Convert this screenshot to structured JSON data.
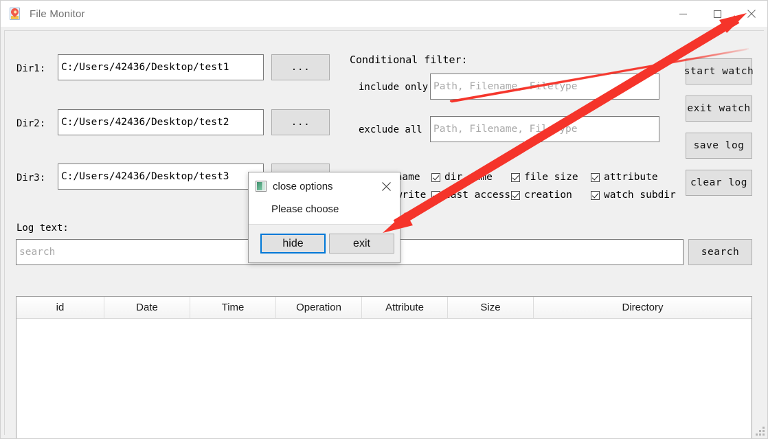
{
  "window": {
    "title": "File Monitor",
    "icon": "file-monitor-icon",
    "minimize_label": "—",
    "maximize_label": "□",
    "close_label": "✕"
  },
  "dirs": [
    {
      "label": "Dir1:",
      "value": "C:/Users/42436/Desktop/test1",
      "browse_label": "..."
    },
    {
      "label": "Dir2:",
      "value": "C:/Users/42436/Desktop/test2",
      "browse_label": "..."
    },
    {
      "label": "Dir3:",
      "value": "C:/Users/42436/Desktop/test3",
      "browse_label": "..."
    }
  ],
  "filter": {
    "heading": "Conditional filter:",
    "include": {
      "label": "include only",
      "value": "",
      "placeholder": "Path, Filename, Filetype"
    },
    "exclude": {
      "label": "exclude  all",
      "value": "",
      "placeholder": "Path, Filename, Filetype"
    }
  },
  "checkboxes": {
    "row1": [
      {
        "label": "file name",
        "checked": true
      },
      {
        "label": "dir name",
        "checked": true
      },
      {
        "label": "file size",
        "checked": true
      },
      {
        "label": "attribute",
        "checked": true
      }
    ],
    "row2": [
      {
        "label": "last write",
        "checked": true
      },
      {
        "label": "last access",
        "checked": true
      },
      {
        "label": "creation",
        "checked": true
      },
      {
        "label": "watch subdir",
        "checked": true
      }
    ]
  },
  "side_buttons": [
    {
      "label": "start watch"
    },
    {
      "label": "exit watch"
    },
    {
      "label": "save log"
    },
    {
      "label": "clear log"
    }
  ],
  "log": {
    "heading": "Log text:",
    "search_value": "",
    "search_placeholder": "search",
    "search_button": "search"
  },
  "table": {
    "columns": [
      "id",
      "Date",
      "Time",
      "Operation",
      "Attribute",
      "Size",
      "Directory"
    ],
    "rows": []
  },
  "dialog": {
    "title": "close options",
    "icon": "app-window-icon",
    "close_label": "✕",
    "message": "Please choose",
    "hide_label": "hide",
    "exit_label": "exit"
  },
  "annotations": {
    "color": "#f5342a",
    "arrow_to_close": "double-headed arrow from exit button to window close button",
    "thin_line": "thin red line across conditional filter toward start watch"
  }
}
